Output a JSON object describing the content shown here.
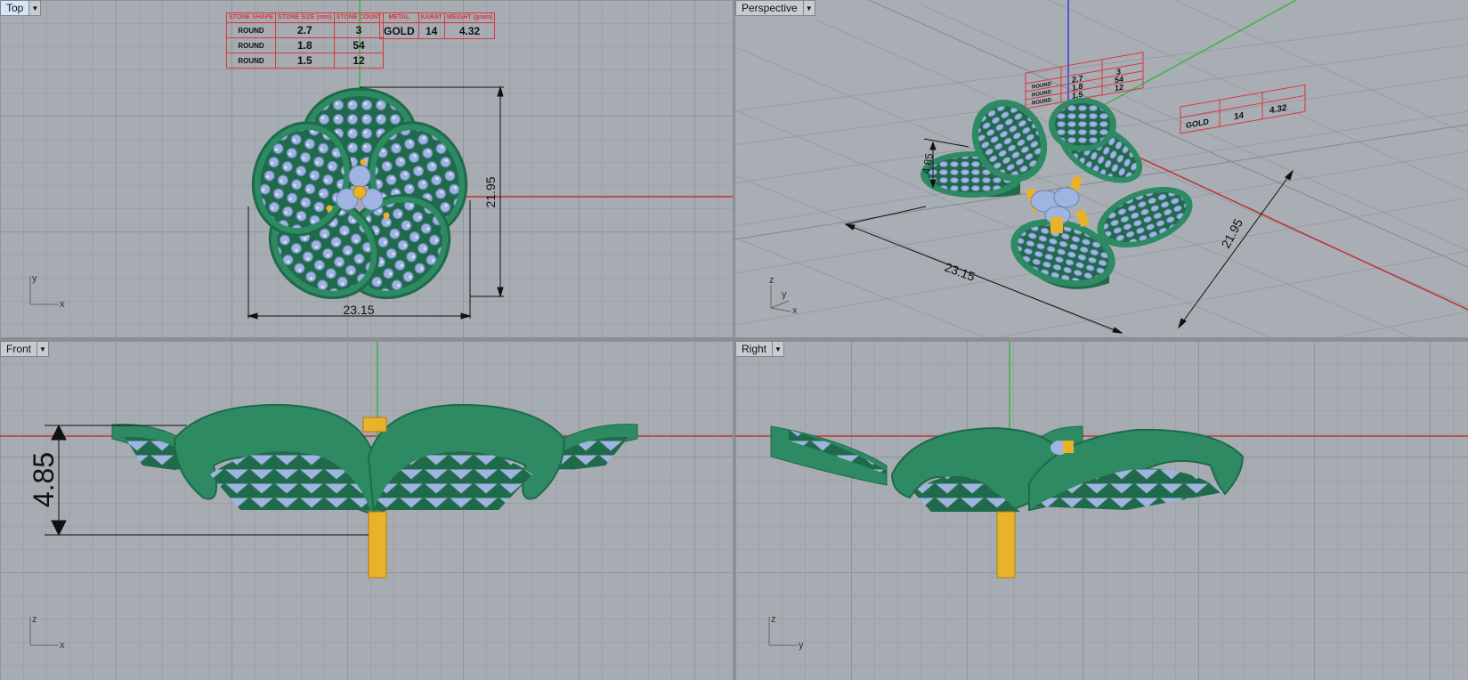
{
  "viewports": {
    "top": {
      "label": "Top",
      "axis_a": "y",
      "axis_b": "x",
      "dim_width": "23.15",
      "dim_height": "21.95"
    },
    "perspective": {
      "label": "Perspective",
      "axis_a": "z",
      "axis_b": "y",
      "axis_c": "x",
      "dim_width": "23.15",
      "dim_depth": "21.95",
      "dim_height": "4.85"
    },
    "front": {
      "label": "Front",
      "axis_a": "z",
      "axis_b": "x",
      "dim_height": "4.85"
    },
    "right": {
      "label": "Right",
      "axis_a": "z",
      "axis_b": "y"
    }
  },
  "stone_table": {
    "headers": [
      "STONE SHAPE",
      "STONE SIZE (mm)",
      "STONE COUNT"
    ],
    "rows": [
      {
        "shape": "ROUND",
        "size": "2.7",
        "count": "3"
      },
      {
        "shape": "ROUND",
        "size": "1.8",
        "count": "54"
      },
      {
        "shape": "ROUND",
        "size": "1.5",
        "count": "12"
      }
    ]
  },
  "metal_table": {
    "headers": [
      "METAL",
      "KARAT",
      "WEIGHT (gram)"
    ],
    "row": {
      "metal": "GOLD",
      "karat": "14",
      "weight": "4.32"
    }
  },
  "colors": {
    "metal_green": "#2e8a62",
    "metal_green_dark": "#1f6a4a",
    "stone_blue": "#9fb4e0",
    "gold": "#e8b22a",
    "axis_red": "#c0312e",
    "axis_green": "#3bb34a",
    "axis_blue": "#3a3adb"
  }
}
